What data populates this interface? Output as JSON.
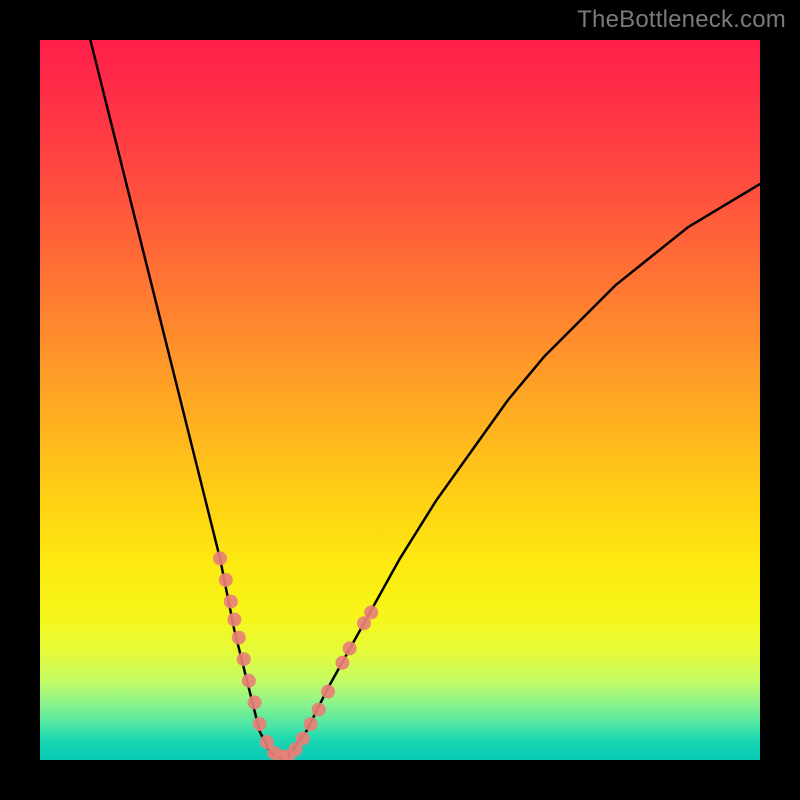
{
  "watermark": "TheBottleneck.com",
  "chart_data": {
    "type": "line",
    "title": "",
    "xlabel": "",
    "ylabel": "",
    "xlim": [
      0,
      100
    ],
    "ylim": [
      0,
      100
    ],
    "grid": false,
    "legend": false,
    "series": [
      {
        "name": "bottleneck-curve",
        "color": "#000000",
        "x": [
          7,
          10,
          13,
          16,
          19,
          22,
          25,
          27,
          29,
          30.5,
          32,
          34,
          37,
          40,
          45,
          50,
          55,
          60,
          65,
          70,
          75,
          80,
          85,
          90,
          95,
          100
        ],
        "y": [
          100,
          88,
          76,
          64,
          52,
          40,
          28,
          18,
          10,
          4,
          1,
          0,
          4,
          10,
          19,
          28,
          36,
          43,
          50,
          56,
          61,
          66,
          70,
          74,
          77,
          80
        ]
      }
    ],
    "markers": [
      {
        "name": "data-points",
        "color": "#e88077",
        "radius": 7,
        "points": [
          {
            "x": 25.0,
            "y": 28.0
          },
          {
            "x": 25.8,
            "y": 25.0
          },
          {
            "x": 26.5,
            "y": 22.0
          },
          {
            "x": 27.0,
            "y": 19.5
          },
          {
            "x": 27.6,
            "y": 17.0
          },
          {
            "x": 28.3,
            "y": 14.0
          },
          {
            "x": 29.0,
            "y": 11.0
          },
          {
            "x": 29.8,
            "y": 8.0
          },
          {
            "x": 30.5,
            "y": 5.0
          },
          {
            "x": 31.5,
            "y": 2.5
          },
          {
            "x": 32.5,
            "y": 1.0
          },
          {
            "x": 33.5,
            "y": 0.5
          },
          {
            "x": 34.5,
            "y": 0.5
          },
          {
            "x": 35.5,
            "y": 1.5
          },
          {
            "x": 36.5,
            "y": 3.0
          },
          {
            "x": 37.6,
            "y": 5.0
          },
          {
            "x": 38.7,
            "y": 7.0
          },
          {
            "x": 40.0,
            "y": 9.5
          },
          {
            "x": 42.0,
            "y": 13.5
          },
          {
            "x": 43.0,
            "y": 15.5
          },
          {
            "x": 45.0,
            "y": 19.0
          },
          {
            "x": 46.0,
            "y": 20.5
          }
        ]
      }
    ]
  }
}
